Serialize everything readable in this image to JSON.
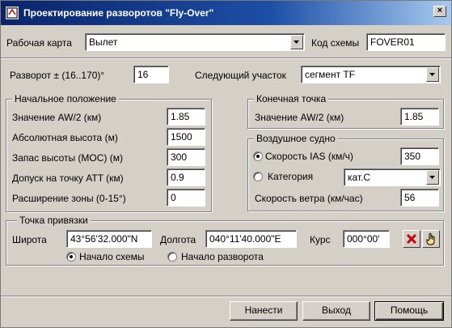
{
  "window": {
    "title": "Проектирование разворотов \"Fly-Over\"",
    "close": "×"
  },
  "top": {
    "work_map_label": "Рабочая карта",
    "work_map_value": "Вылет",
    "scheme_code_label": "Код схемы",
    "scheme_code_value": "FOVER01"
  },
  "turn": {
    "label": "Разворот ± (16..170)°",
    "value": "16",
    "next_segment_label": "Следующий участок",
    "next_segment_value": "сегмент TF"
  },
  "initial": {
    "title": "Начальное положение",
    "aw_label": "Значение AW/2 (км)",
    "aw_value": "1.85",
    "alt_label": "Абсолютная высота (м)",
    "alt_value": "1500",
    "moc_label": "Запас высоты (MOC) (м)",
    "moc_value": "300",
    "att_label": "Допуск на точку ATT (км)",
    "att_value": "0.9",
    "ext_label": "Расширение зоны (0-15°)",
    "ext_value": "0"
  },
  "end_point": {
    "title": "Конечная точка",
    "aw_label": "Значение AW/2 (км)",
    "aw_value": "1.85"
  },
  "aircraft": {
    "title": "Воздушное судно",
    "ias_label": "Скорость IAS (км/ч)",
    "ias_value": "350",
    "category_label": "Категория",
    "category_value": "кат.С",
    "wind_label": "Скорость ветра (км/час)",
    "wind_value": "56"
  },
  "anchor": {
    "title": "Точка привязки",
    "lat_label": "Широта",
    "lat_value": "43°56'32.000\"N",
    "lon_label": "Долгота",
    "lon_value": "040°11'40.000\"E",
    "course_label": "Курс",
    "course_value": "000°00'",
    "scheme_start_label": "Начало схемы",
    "turn_start_label": "Начало разворота"
  },
  "buttons": {
    "apply": "Нанести",
    "exit": "Выход",
    "help": "Помощь"
  }
}
